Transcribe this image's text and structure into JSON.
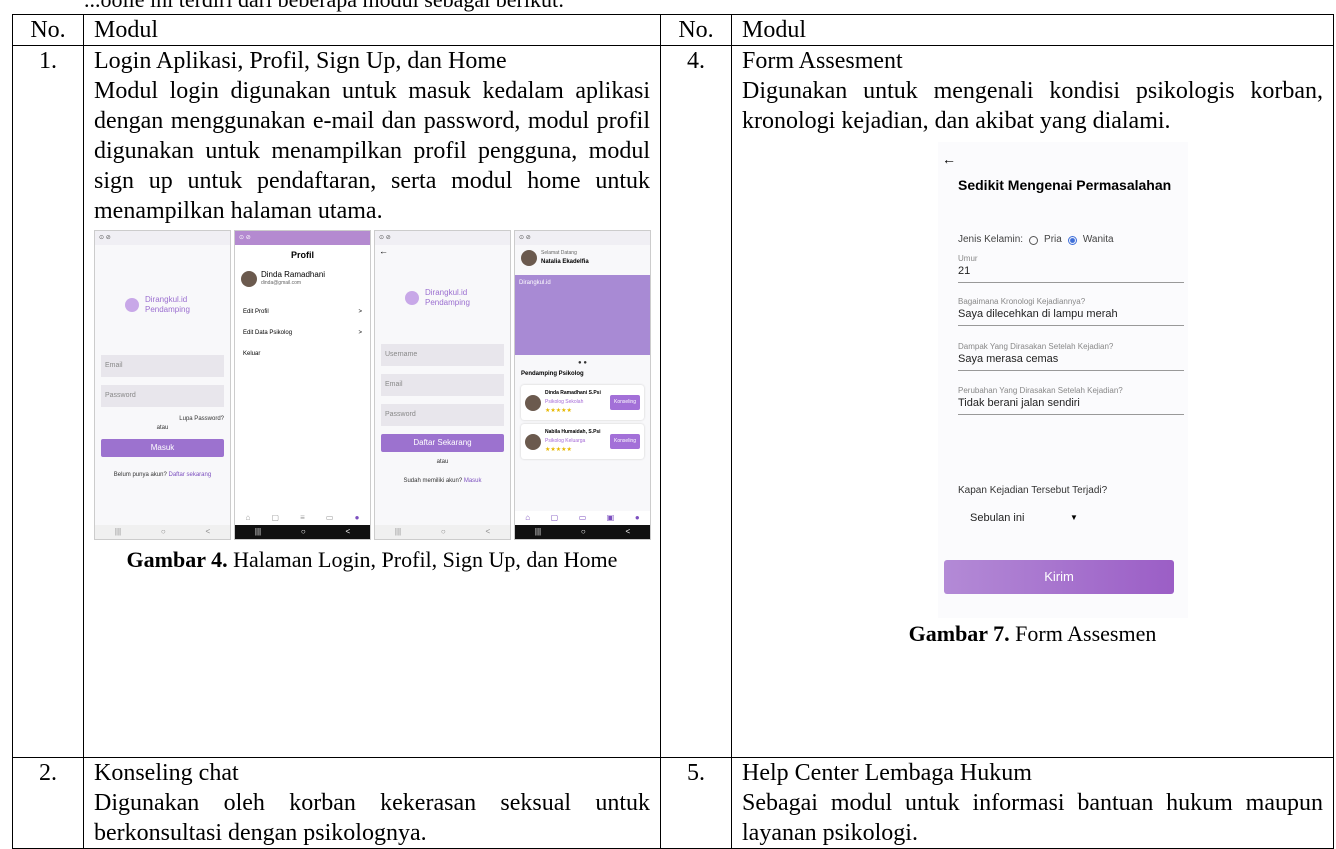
{
  "intro_text": "...ooile ini terdiri dari beberapa modul sebagai berikut:",
  "table": {
    "headers": {
      "no_left": "No.",
      "modul_left": "Modul",
      "no_right": "No.",
      "modul_right": "Modul"
    },
    "rows": [
      {
        "left": {
          "no": "1.",
          "title": "Login Aplikasi, Profil, Sign Up, dan Home",
          "desc": "Modul login digunakan untuk masuk kedalam aplikasi dengan menggunakan e-mail dan password, modul profil digunakan untuk menampilkan profil pengguna, modul sign up untuk pendaftaran, serta modul home untuk menampilkan halaman utama.",
          "caption_bold": "Gambar 4.",
          "caption_text": " Halaman Login, Profil, Sign Up, dan Home"
        },
        "right": {
          "no": "4.",
          "title": "Form Assesment",
          "desc": "Digunakan untuk mengenali kondisi psikologis korban, kronologi kejadian, dan akibat yang dialami.",
          "caption_bold": "Gambar 7.",
          "caption_text": " Form Assesmen"
        }
      },
      {
        "left": {
          "no": "2.",
          "title": "Konseling chat",
          "desc": "Digunakan oleh korban kekerasan seksual untuk berkonsultasi dengan psikolognya."
        },
        "right": {
          "no": "5.",
          "title": "Help Center Lembaga Hukum",
          "desc": "Sebagai modul untuk informasi bantuan hukum maupun layanan psikologi."
        }
      }
    ]
  },
  "screens": {
    "login": {
      "brand1": "Dirangkul.id",
      "brand2": "Pendamping",
      "email": "Email",
      "password": "Password",
      "forgot": "Lupa Password?",
      "or": "atau",
      "button": "Masuk",
      "footer": "Belum punya akun?",
      "footer_link": "Daftar sekarang"
    },
    "profile": {
      "title": "Profil",
      "name": "Dinda Ramadhani",
      "email": "dinda@gmail.com",
      "item1": "Edit Profil",
      "item2": "Edit Data Psikolog",
      "item3": "Keluar"
    },
    "signup": {
      "brand1": "Dirangkul.id",
      "brand2": "Pendamping",
      "username": "Username",
      "email": "Email",
      "password": "Password",
      "button": "Daftar Sekarang",
      "or": "atau",
      "footer": "Sudah memiliki akun?",
      "footer_link": "Masuk"
    },
    "home": {
      "greet": "Selamat Datang",
      "user": "Natalia Ekadelfia",
      "hero": "Dirangkul.id",
      "section": "Pendamping Psikolog",
      "c1_name": "Dinda Ramadhani S.Psi",
      "c1_role": "Psikolog Sekolah",
      "c2_name": "Nabila Humaidah, S.Psi",
      "c2_role": "Psikolog Keluarga",
      "c_btn": "Konseling",
      "stars": "★★★★★"
    }
  },
  "form": {
    "back": "←",
    "title": "Sedikit Mengenai Permasalahan",
    "gender_label": "Jenis Kelamin:",
    "opt1": "Pria",
    "opt2": "Wanita",
    "age_label": "Umur",
    "age_value": "21",
    "q1_label": "Bagaimana Kronologi Kejadiannya?",
    "q1_value": "Saya dilecehkan di lampu merah",
    "q2_label": "Dampak Yang Dirasakan Setelah Kejadian?",
    "q2_value": "Saya merasa cemas",
    "q3_label": "Perubahan Yang Dirasakan Setelah Kejadian?",
    "q3_value": "Tidak berani jalan sendiri",
    "when_label": "Kapan Kejadian Tersebut Terjadi?",
    "when_value": "Sebulan ini",
    "submit": "Kirim"
  }
}
